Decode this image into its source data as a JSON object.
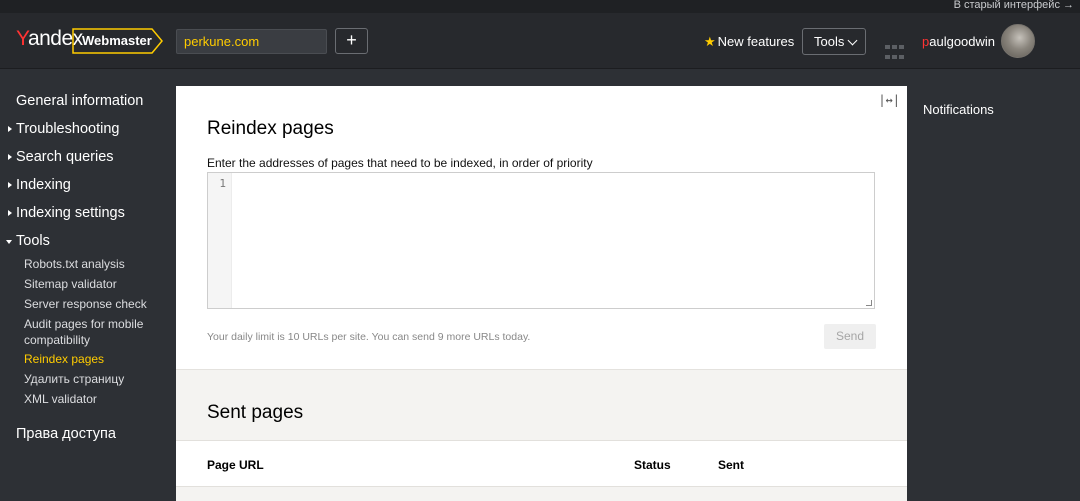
{
  "top_bar": {
    "old_interface_link": "В старый интерфейс →"
  },
  "header": {
    "logo": {
      "first_letter": "Y",
      "rest": "andex"
    },
    "service_name": "Webmaster",
    "site": "perkune.com",
    "add_site_label": "+",
    "new_features_label": "New features",
    "tools_label": "Tools",
    "user": {
      "first_letter": "p",
      "rest": "aulgoodwin"
    }
  },
  "sidebar": {
    "general": "General information",
    "troubleshooting": "Troubleshooting",
    "search_queries": "Search queries",
    "indexing": "Indexing",
    "indexing_settings": "Indexing settings",
    "tools": "Tools",
    "tools_items": {
      "robots": "Robots.txt analysis",
      "sitemap": "Sitemap validator",
      "server": "Server response check",
      "audit": "Audit pages for mobile compatibility",
      "reindex": "Reindex pages",
      "delete": "Удалить страницу",
      "xml": "XML validator"
    },
    "access_rights": "Права доступа"
  },
  "main": {
    "title": "Reindex pages",
    "field_label": "Enter the addresses of pages that need to be indexed, in order of priority",
    "line_number": "1",
    "limit_text": "Your daily limit is 10 URLs per site. You can send 9 more URLs today.",
    "send_label": "Send",
    "expand_icon": "|↔|",
    "sent": {
      "title": "Sent pages",
      "col_url": "Page URL",
      "col_status": "Status",
      "col_sent": "Sent"
    }
  },
  "notifications": {
    "title": "Notifications"
  },
  "colors": {
    "accent": "#ffcc00",
    "brand_red": "#ff3333",
    "background": "#2d3035",
    "panel": "#ffffff"
  }
}
